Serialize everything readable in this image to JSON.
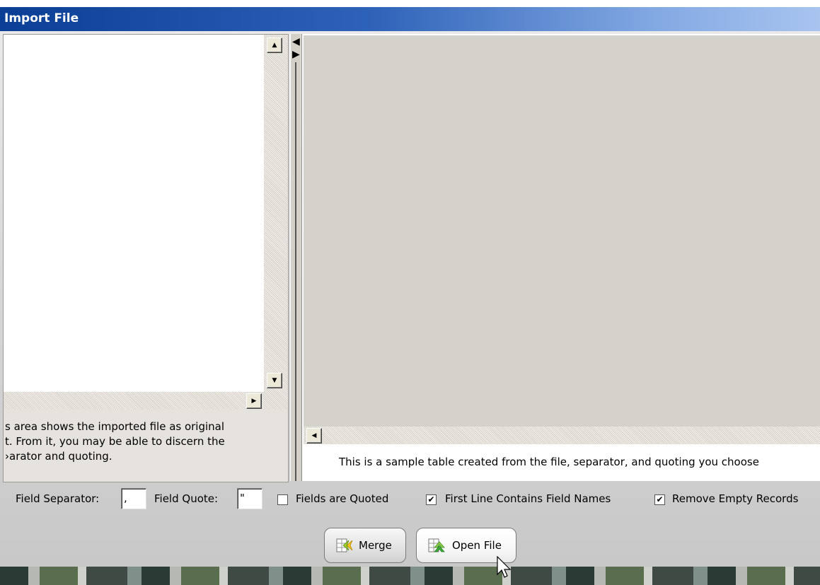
{
  "window": {
    "title": "Import File"
  },
  "left_pane": {
    "description": "s area shows the imported file as original\nt. From it, you may be able to discern the\n›arator and quoting."
  },
  "right_pane": {
    "description": "This is a sample table created from the file, separator, and quoting you choose"
  },
  "options": {
    "field_separator_label": "Field Separator:",
    "field_separator_value": ",",
    "field_quote_label": "Field Quote:",
    "field_quote_value": "\"",
    "fields_quoted_label": "Fields are Quoted",
    "fields_quoted_checked": false,
    "first_line_label": "First Line Contains Field Names",
    "first_line_checked": true,
    "remove_empty_label": "Remove Empty Records",
    "remove_empty_checked": true
  },
  "buttons": {
    "merge": "Merge",
    "open_file": "Open File"
  },
  "colors": {
    "title_bar_start": "#0b3e95",
    "title_bar_end": "#a8c4ef",
    "table_background": "#d5d1cb"
  }
}
